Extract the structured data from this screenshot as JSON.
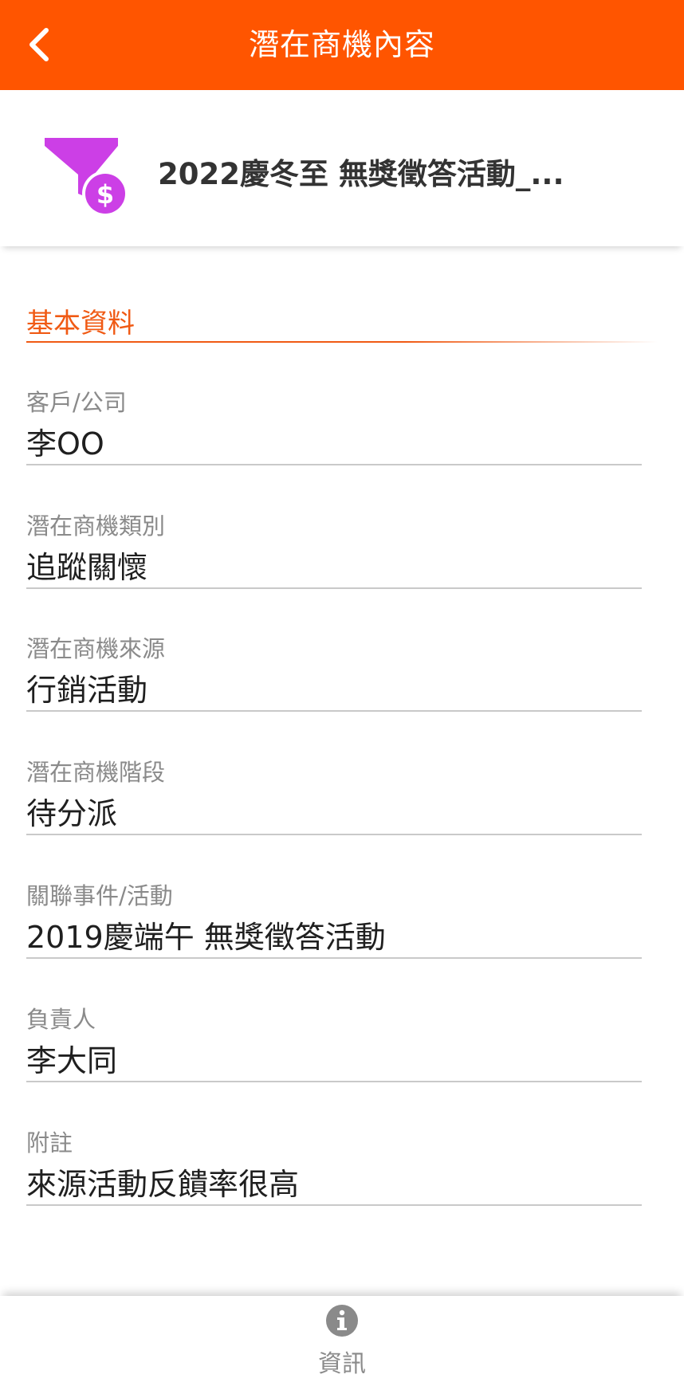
{
  "topbar": {
    "title": "潛在商機內容",
    "back_icon": "chevron-left-icon",
    "color": "#ff5500"
  },
  "header": {
    "icon": "funnel-dollar-icon",
    "icon_color": "#cc3fe6",
    "title": "2022慶冬至 無獎徵答活動_..."
  },
  "section": {
    "title": "基本資料",
    "accent": "#f05a14"
  },
  "fields": [
    {
      "label": "客戶/公司",
      "value": "李OO"
    },
    {
      "label": "潛在商機類別",
      "value": "追蹤關懷"
    },
    {
      "label": "潛在商機來源",
      "value": "行銷活動"
    },
    {
      "label": "潛在商機階段",
      "value": "待分派"
    },
    {
      "label": "關聯事件/活動",
      "value": "2019慶端午 無獎徵答活動"
    },
    {
      "label": "負責人",
      "value": "李大同"
    },
    {
      "label": "附註",
      "value": "來源活動反饋率很高"
    }
  ],
  "bottom_tabs": [
    {
      "label": "資訊",
      "icon": "info-circle-icon"
    }
  ]
}
